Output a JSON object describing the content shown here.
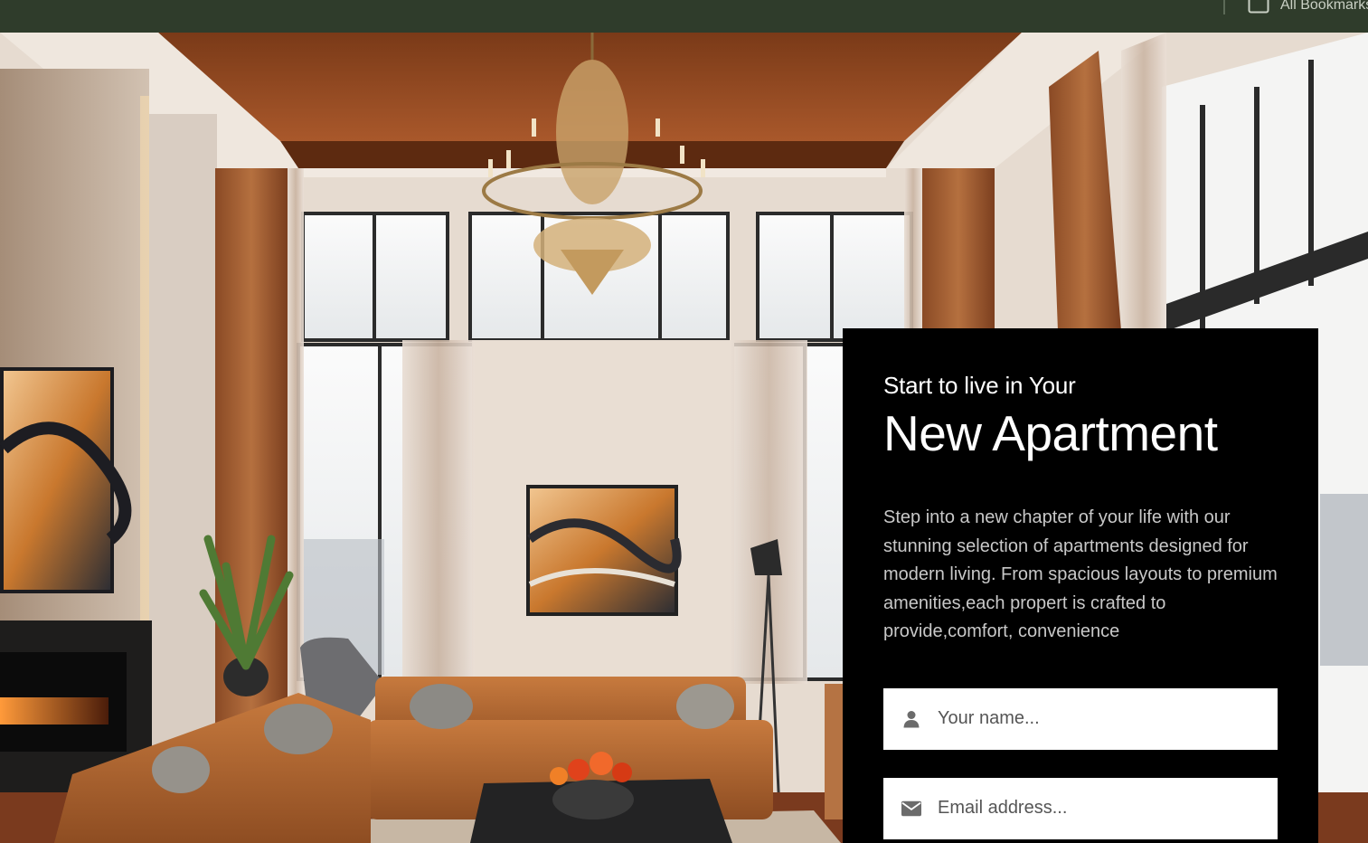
{
  "browser": {
    "bookmarks_folder_label": "All Bookmarks",
    "bar_color": "#2f3c2b"
  },
  "hero": {
    "image_description_icon": "living-room-photo"
  },
  "signup": {
    "eyebrow": "Start to live in Your",
    "headline": "New Apartment",
    "description": "Step into a new chapter of your life with our stunning selection of apartments designed for modern living. From spacious layouts to premium amenities,each propert is crafted to provide,comfort, convenience",
    "name_field": {
      "placeholder": "Your name...",
      "icon": "user-icon"
    },
    "email_field": {
      "placeholder": "Email address...",
      "icon": "envelope-icon"
    },
    "card_color": "#000000"
  }
}
